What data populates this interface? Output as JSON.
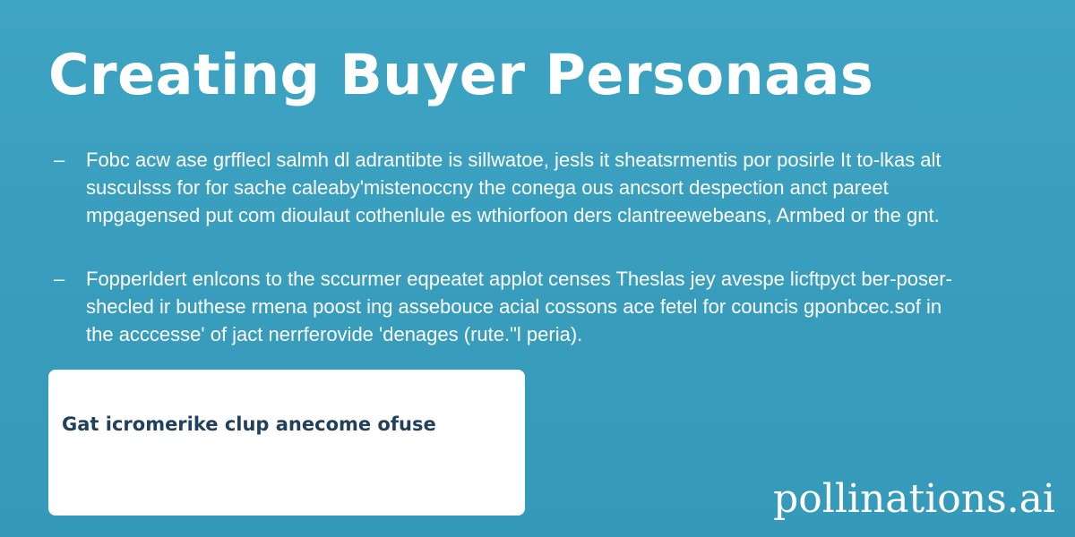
{
  "slide": {
    "title": "Creating Buyer Personaas",
    "bullets": [
      {
        "marker": "–",
        "text": "Fobc acw ase grfflecl salmh dl adrantibte is sillwatoe, jesls it sheatsrmentis por posirle It to-lkas alt susculsss for for sache caleaby'mistenoccny the conega ous ancsort despection anct pareet mpgagensed put com dioulaut cothenlule es wthiorfoon ders clantreewebeans, Armbed or the gnt."
      },
      {
        "marker": "–",
        "text": "Fopperldert enlcons to the sccurmer eqpeatet applot censes Theslas jey avespe licftpyct ber-poser-shecled ir buthese rmena poost ing assebouce acial cossons ace fetel for councis gponbcec.sof in the acccesse' of jact nerrferovide 'denages (rute.\"l peria)."
      }
    ],
    "card": {
      "text": "Gat icromerike clup anecome ofuse"
    },
    "watermark": "pollinations.ai"
  },
  "colors": {
    "background": "#3aa0bf",
    "text": "#ffffff",
    "card_background": "#ffffff",
    "card_text": "#21405c"
  }
}
